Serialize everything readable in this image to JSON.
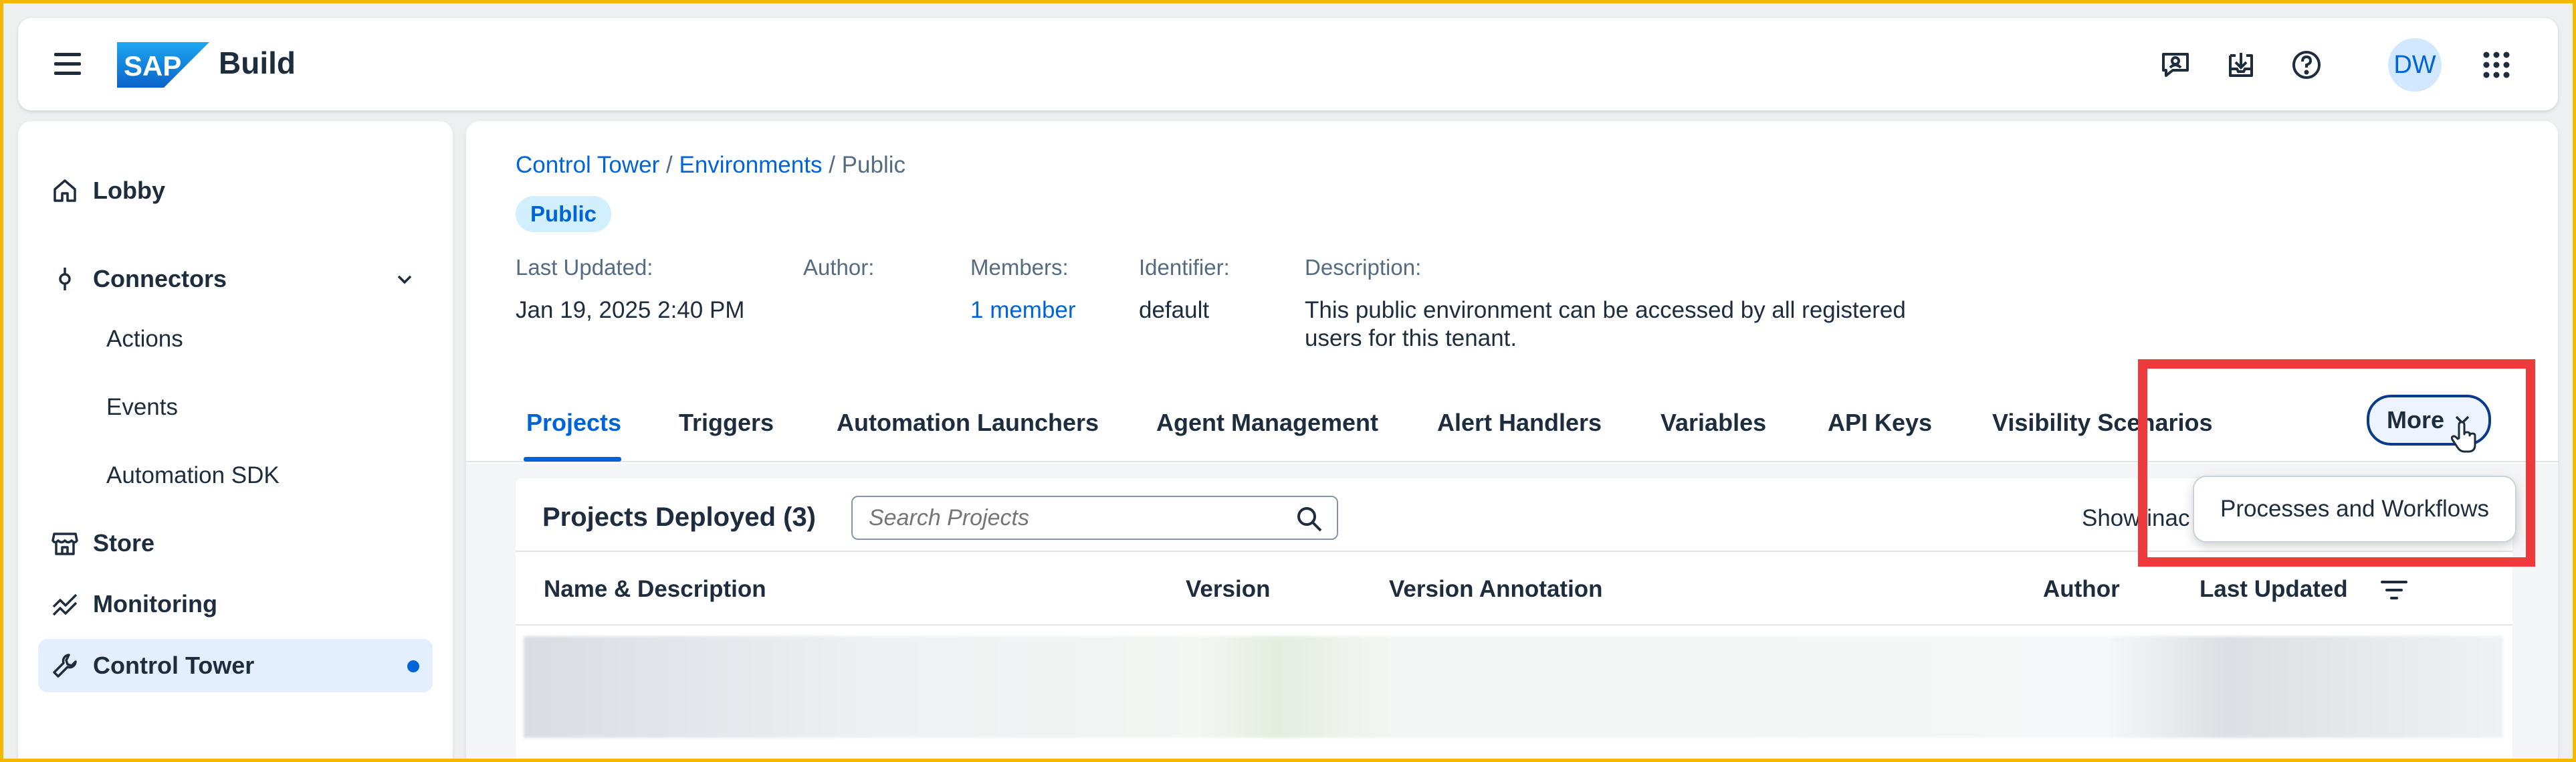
{
  "shell": {
    "product_name": "Build",
    "logo_text": "SAP",
    "avatar_initials": "DW",
    "icons": [
      "menu-icon",
      "feedback-icon",
      "inbox-download-icon",
      "help-icon",
      "app-grid-icon"
    ]
  },
  "sidebar": {
    "items": [
      {
        "label": "Lobby",
        "icon": "home-icon"
      },
      {
        "label": "Connectors",
        "icon": "connector-icon"
      },
      {
        "label": "Actions"
      },
      {
        "label": "Events"
      },
      {
        "label": "Automation SDK"
      },
      {
        "label": "Store",
        "icon": "store-icon"
      },
      {
        "label": "Monitoring",
        "icon": "monitoring-icon"
      },
      {
        "label": "Control Tower",
        "icon": "wrench-icon"
      }
    ]
  },
  "breadcrumb": {
    "items": [
      "Control Tower",
      "Environments",
      "Public"
    ],
    "sep": "/"
  },
  "badge": "Public",
  "meta": {
    "last_updated_label": "Last Updated:",
    "last_updated_value": "Jan 19, 2025 2:40 PM",
    "author_label": "Author:",
    "members_label": "Members:",
    "members_value": "1 member",
    "identifier_label": "Identifier:",
    "identifier_value": "default",
    "description_label": "Description:",
    "description_line1": "This public environment can be accessed by all registered",
    "description_line2": "users for this tenant."
  },
  "tabs": [
    "Projects",
    "Triggers",
    "Automation Launchers",
    "Agent Management",
    "Alert Handlers",
    "Variables",
    "API Keys",
    "Visibility Scenarios"
  ],
  "more_button": "More",
  "dropdown": {
    "items": [
      "Processes and Workflows"
    ]
  },
  "projects": {
    "title": "Projects Deployed (3)",
    "search_placeholder": "Search Projects",
    "show_inactive": "Show inac",
    "columns": [
      "Name & Description",
      "Version",
      "Version Annotation",
      "Author",
      "Last Updated"
    ]
  },
  "colors": {
    "accent": "#0064d9",
    "highlight": "#ee3a3a",
    "frame": "#f5b800"
  }
}
